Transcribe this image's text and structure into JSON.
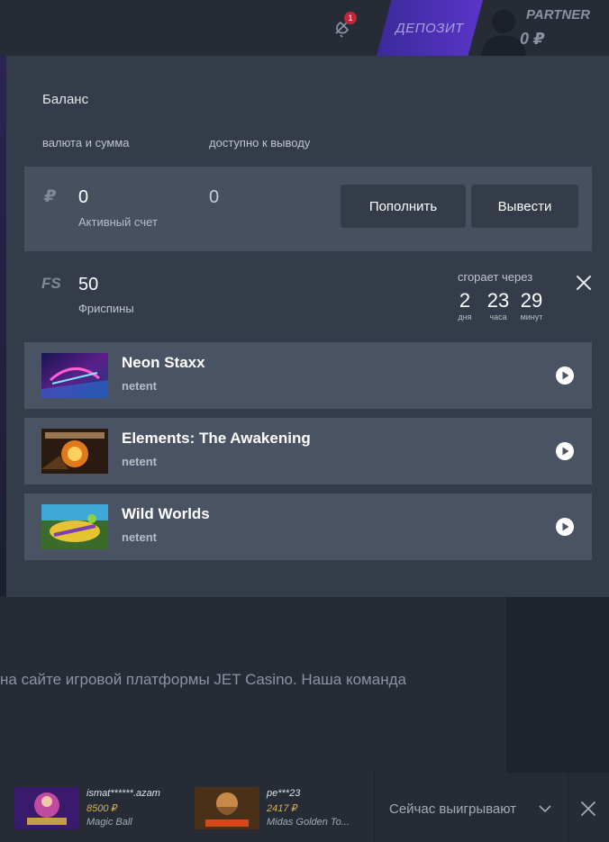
{
  "header": {
    "notification_count": "1",
    "deposit_label": "ДЕПОЗИТ",
    "user_name": "PARTNER",
    "user_balance": "0 ₽"
  },
  "background": {
    "text": "на сайте игровой платформы JET Casino. Наша команда"
  },
  "modal": {
    "title": "Баланс",
    "col_currency": "валюта и сумма",
    "col_available": "доступно к выводу",
    "currency_symbol": "₽",
    "amount": "0",
    "account_label": "Активный счет",
    "available_amount": "0",
    "topup_button": "Пополнить",
    "withdraw_button": "Вывести",
    "freespins": {
      "icon_label": "FS",
      "count": "50",
      "label": "Фриспины",
      "expires_label": "сгорает через",
      "days": "2",
      "days_unit": "дня",
      "hours": "23",
      "hours_unit": "часа",
      "minutes": "29",
      "minutes_unit": "минут"
    },
    "games": [
      {
        "name": "Neon Staxx",
        "provider": "netent"
      },
      {
        "name": "Elements: The Awakening",
        "provider": "netent"
      },
      {
        "name": "Wild Worlds",
        "provider": "netent"
      }
    ]
  },
  "bottom_bar": {
    "winners": [
      {
        "user": "ismat******.azam",
        "amount": "8500 ₽",
        "game": "Magic Ball"
      },
      {
        "user": "pe***23",
        "amount": "2417 ₽",
        "game": "Midas Golden To..."
      }
    ],
    "now_winning_label": "Сейчас выигрывают"
  },
  "colors": {
    "modal_bg": "#343c49",
    "row_bg": "#4a5363",
    "deposit_accent": "#5a35c8",
    "win_amount": "#d9b24a"
  }
}
